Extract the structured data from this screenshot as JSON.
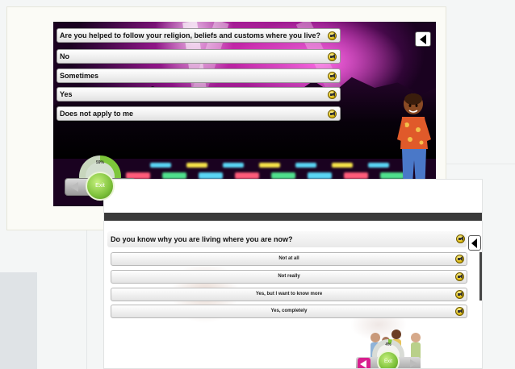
{
  "screen1": {
    "question": "Are you helped to follow your religion, beliefs and customs where you live?",
    "answers": [
      "No",
      "Sometimes",
      "Yes",
      "Does not apply to me"
    ],
    "progress": {
      "label": "59%",
      "value": 0.59
    },
    "exit_label": "Exit"
  },
  "screen2": {
    "question": "Do you know why you are living where you are now?",
    "answers": [
      "Not at all",
      "Not really",
      "Yes, but I want to know more",
      "Yes, completely"
    ],
    "progress": {
      "label": "4%",
      "value": 0.04
    },
    "exit_label": "Exit"
  },
  "icons": {
    "speaker": "speaker-icon",
    "back": "back-arrow-icon",
    "prev": "previous-arrow-icon",
    "next": "next-arrow-icon"
  },
  "colors": {
    "accent_green": "#7dc63a",
    "back_pink": "#d81f8e",
    "stage_magenta": "#cf2cb0"
  }
}
